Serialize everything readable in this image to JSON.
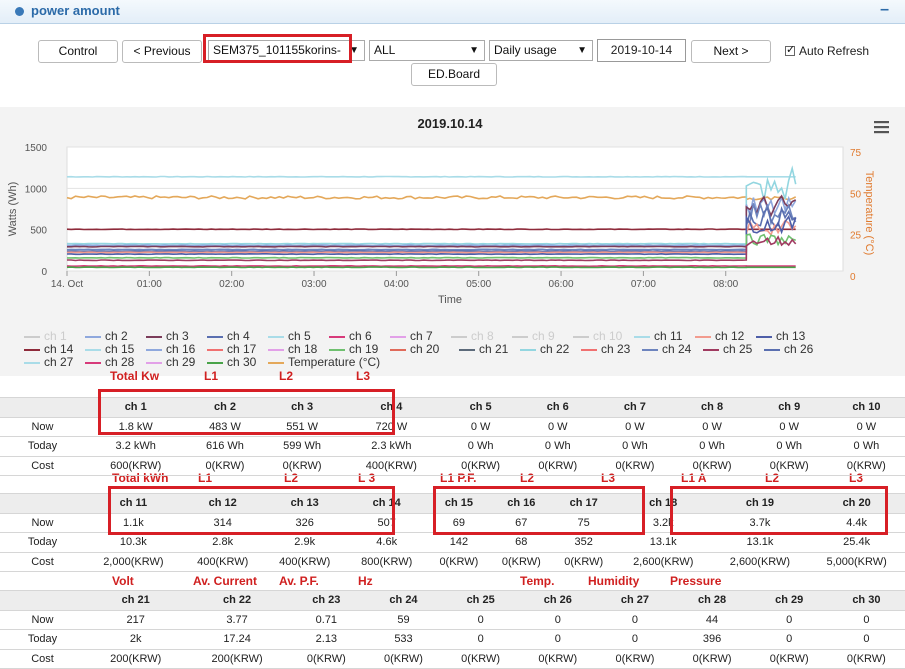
{
  "panel": {
    "title": "power amount",
    "collapse_symbol": "–"
  },
  "toolbar": {
    "control_label": "Control",
    "previous_label": "< Previous",
    "device_value": "SEM375_101155korins-",
    "channel_value": "ALL",
    "mode_value": "Daily usage",
    "date_value": "2019-10-14",
    "next_label": "Next >",
    "auto_refresh_label": "Auto Refresh",
    "auto_refresh_checked": true,
    "edboard_label": "ED.Board"
  },
  "chart_data": {
    "type": "line",
    "title": "2019.10.14",
    "xlabel": "Time",
    "ylabel": "Watts (Wh)",
    "y2label": "Temperature (°C)",
    "x_ticks": [
      "14. Oct",
      "01:00",
      "02:00",
      "03:00",
      "04:00",
      "05:00",
      "06:00",
      "07:00",
      "08:00"
    ],
    "y_ticks": [
      "0",
      "500",
      "1000",
      "1500"
    ],
    "y2_ticks": [
      "0",
      "25",
      "50",
      "75"
    ],
    "ylim": [
      0,
      1500
    ],
    "y2lim": [
      0,
      75
    ],
    "x_range_hours": [
      0,
      9
    ],
    "menu_icon": "hamburger-icon",
    "series": [
      {
        "name": "ch 15",
        "color": "#a9dce8",
        "base": 1140,
        "late": 1140
      },
      {
        "name": "Temperature (°C)",
        "color": "#e4a85a",
        "base": 890,
        "late": 880,
        "noise": 18
      },
      {
        "name": "ch 14",
        "color": "#8e2a3a",
        "base": 505,
        "late": 505
      },
      {
        "name": "ch 22",
        "color": "#93d6e0",
        "base": 330,
        "late": 980,
        "spike": 1240
      },
      {
        "name": "ch 2",
        "color": "#8fa8dd",
        "base": 310,
        "late": 760
      },
      {
        "name": "ch 3",
        "color": "#7b3c5a",
        "base": 295,
        "late": 780
      },
      {
        "name": "ch 24",
        "color": "#6d84be",
        "base": 260,
        "late": 700
      },
      {
        "name": "ch 4",
        "color": "#5a6fb0",
        "base": 240,
        "late": 650
      },
      {
        "name": "ch 12",
        "color": "#f29b8e",
        "base": 225,
        "late": 520
      },
      {
        "name": "ch 13",
        "color": "#4e5ea8",
        "base": 205,
        "late": 560
      },
      {
        "name": "ch 19",
        "color": "#6fc06f",
        "base": 160,
        "late": 380
      },
      {
        "name": "ch 25",
        "color": "#a03a60",
        "base": 130,
        "late": 360
      },
      {
        "name": "ch 28",
        "color": "#d73a7a",
        "base": 60,
        "late": 60
      },
      {
        "name": "ch 30",
        "color": "#49a349",
        "base": 45,
        "late": 45
      }
    ]
  },
  "legend": [
    {
      "label": "ch 1",
      "color": "#ccc",
      "off": true
    },
    {
      "label": "ch 2",
      "color": "#8fa8dd"
    },
    {
      "label": "ch 3",
      "color": "#7b3c5a"
    },
    {
      "label": "ch 4",
      "color": "#5a6fb0"
    },
    {
      "label": "ch 5",
      "color": "#a9dce8"
    },
    {
      "label": "ch 6",
      "color": "#d73a7a"
    },
    {
      "label": "ch 7",
      "color": "#e2a0e8"
    },
    {
      "label": "ch 8",
      "color": "#ccc",
      "off": true
    },
    {
      "label": "ch 9",
      "color": "#ccc",
      "off": true
    },
    {
      "label": "ch 10",
      "color": "#ccc",
      "off": true
    },
    {
      "label": "ch 11",
      "color": "#a9dce8"
    },
    {
      "label": "ch 12",
      "color": "#f29b8e"
    },
    {
      "label": "ch 13",
      "color": "#4e5ea8"
    },
    {
      "label": "ch 14",
      "color": "#8e2a3a"
    },
    {
      "label": "ch 15",
      "color": "#a9dce8"
    },
    {
      "label": "ch 16",
      "color": "#8fa8dd"
    },
    {
      "label": "ch 17",
      "color": "#f07070"
    },
    {
      "label": "ch 18",
      "color": "#e2a0e8"
    },
    {
      "label": "ch 19",
      "color": "#6fc06f"
    },
    {
      "label": "ch 20",
      "color": "#e06a5a"
    },
    {
      "label": "ch 21",
      "color": "#5c6a7a"
    },
    {
      "label": "ch 22",
      "color": "#93d6e0"
    },
    {
      "label": "ch 23",
      "color": "#f07070"
    },
    {
      "label": "ch 24",
      "color": "#6d84be"
    },
    {
      "label": "ch 25",
      "color": "#a03a60"
    },
    {
      "label": "ch 26",
      "color": "#5a6fb0"
    },
    {
      "label": "ch 27",
      "color": "#a9dce8"
    },
    {
      "label": "ch 28",
      "color": "#d73a7a"
    },
    {
      "label": "ch 29",
      "color": "#e2a0e8"
    },
    {
      "label": "ch 30",
      "color": "#49a349"
    },
    {
      "label": "Temperature (°C)",
      "color": "#e4a85a"
    }
  ],
  "annotations": {
    "group1": [
      "Total Kw",
      "L1",
      "L2",
      "L3"
    ],
    "group2": [
      "Total kWh",
      "L1",
      "L2",
      "L 3",
      "L1  P.F.",
      "L2",
      "L3",
      "L1  A",
      "L2",
      "L3"
    ],
    "group3": [
      "Volt",
      "Av. Current",
      "Av. P.F.",
      "Hz",
      "Temp.",
      "Humidity",
      "Pressure"
    ]
  },
  "tables": [
    {
      "headers": [
        "ch 1",
        "ch 2",
        "ch 3",
        "ch 4",
        "ch 5",
        "ch 6",
        "ch 7",
        "ch 8",
        "ch 9",
        "ch 10"
      ],
      "rows": [
        {
          "label": "Now",
          "values": [
            "1.8 kW",
            "483 W",
            "551 W",
            "720 W",
            "0 W",
            "0 W",
            "0 W",
            "0 W",
            "0 W",
            "0 W"
          ]
        },
        {
          "label": "Today",
          "values": [
            "3.2 kWh",
            "616 Wh",
            "599 Wh",
            "2.3 kWh",
            "0 Wh",
            "0 Wh",
            "0 Wh",
            "0 Wh",
            "0 Wh",
            "0 Wh"
          ]
        },
        {
          "label": "Cost",
          "values": [
            "600(KRW)",
            "0(KRW)",
            "0(KRW)",
            "400(KRW)",
            "0(KRW)",
            "0(KRW)",
            "0(KRW)",
            "0(KRW)",
            "0(KRW)",
            "0(KRW)"
          ]
        }
      ]
    },
    {
      "headers": [
        "ch 11",
        "ch 12",
        "ch 13",
        "ch 14",
        "ch 15",
        "ch 16",
        "ch 17",
        "ch 18",
        "ch 19",
        "ch 20"
      ],
      "rows": [
        {
          "label": "Now",
          "values": [
            "1.1k",
            "314",
            "326",
            "507",
            "69",
            "67",
            "75",
            "3.2k",
            "3.7k",
            "4.4k"
          ]
        },
        {
          "label": "Today",
          "values": [
            "10.3k",
            "2.8k",
            "2.9k",
            "4.6k",
            "142",
            "68",
            "352",
            "13.1k",
            "13.1k",
            "25.4k"
          ]
        },
        {
          "label": "Cost",
          "values": [
            "2,000(KRW)",
            "400(KRW)",
            "400(KRW)",
            "800(KRW)",
            "0(KRW)",
            "0(KRW)",
            "0(KRW)",
            "2,600(KRW)",
            "2,600(KRW)",
            "5,000(KRW)"
          ]
        }
      ]
    },
    {
      "headers": [
        "ch 21",
        "ch 22",
        "ch 23",
        "ch 24",
        "ch 25",
        "ch 26",
        "ch 27",
        "ch 28",
        "ch 29",
        "ch 30"
      ],
      "rows": [
        {
          "label": "Now",
          "values": [
            "217",
            "3.77",
            "0.71",
            "59",
            "0",
            "0",
            "0",
            "44",
            "0",
            "0"
          ]
        },
        {
          "label": "Today",
          "values": [
            "2k",
            "17.24",
            "2.13",
            "533",
            "0",
            "0",
            "0",
            "396",
            "0",
            "0"
          ]
        },
        {
          "label": "Cost",
          "values": [
            "200(KRW)",
            "200(KRW)",
            "0(KRW)",
            "0(KRW)",
            "0(KRW)",
            "0(KRW)",
            "0(KRW)",
            "0(KRW)",
            "0(KRW)",
            "0(KRW)"
          ]
        }
      ]
    }
  ]
}
